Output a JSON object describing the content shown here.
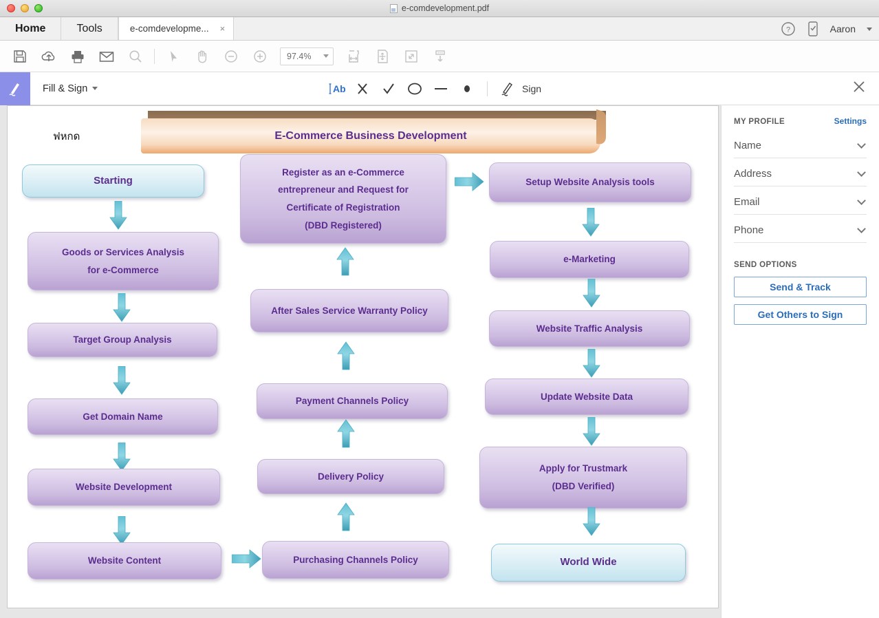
{
  "window": {
    "title": "e-comdevelopment.pdf",
    "traffic_lights": [
      "close",
      "minimize",
      "zoom"
    ]
  },
  "tabs": {
    "home_label": "Home",
    "tools_label": "Tools",
    "doc_label": "e-comdevelopme...",
    "close_label": "×"
  },
  "account": {
    "username": "Aaron",
    "help_icon": "help-circle-icon",
    "mobile_icon": "mobile-link-icon"
  },
  "toolbar": {
    "buttons": [
      {
        "name": "save-button",
        "icon": "floppy-disk-icon"
      },
      {
        "name": "upload-cloud-button",
        "icon": "cloud-upload-icon"
      },
      {
        "name": "print-button",
        "icon": "printer-icon"
      },
      {
        "name": "email-button",
        "icon": "envelope-icon"
      },
      {
        "name": "search-button",
        "icon": "magnifier-icon"
      },
      {
        "name": "select-tool-button",
        "icon": "cursor-arrow-icon"
      },
      {
        "name": "hand-tool-button",
        "icon": "hand-icon"
      },
      {
        "name": "zoom-out-button",
        "icon": "minus-circle-icon"
      },
      {
        "name": "zoom-in-button",
        "icon": "plus-circle-icon"
      },
      {
        "name": "fit-width-button",
        "icon": "fit-width-icon"
      },
      {
        "name": "fit-page-button",
        "icon": "fit-page-icon"
      },
      {
        "name": "full-screen-button",
        "icon": "expand-arrows-icon"
      },
      {
        "name": "scroll-down-button",
        "icon": "scroll-down-icon"
      }
    ],
    "zoom_value": "97.4%"
  },
  "fill_and_sign": {
    "mode_label": "Fill & Sign",
    "tools": [
      {
        "name": "add-text-tool",
        "glyph": "Ab",
        "active": true
      },
      {
        "name": "cross-mark-tool",
        "glyph": "✕",
        "active": false
      },
      {
        "name": "check-mark-tool",
        "glyph": "✓",
        "active": false
      },
      {
        "name": "circle-tool",
        "glyph": "◯",
        "active": false
      },
      {
        "name": "line-tool",
        "glyph": "—",
        "active": false
      },
      {
        "name": "dot-tool",
        "glyph": "●",
        "active": false
      }
    ],
    "sign_label": "Sign",
    "close_label": "✕"
  },
  "sidebar": {
    "profile_title": "MY PROFILE",
    "settings_link": "Settings",
    "fields": [
      {
        "label": "Name"
      },
      {
        "label": "Address"
      },
      {
        "label": "Email"
      },
      {
        "label": "Phone"
      }
    ],
    "send_options_title": "SEND OPTIONS",
    "buttons": [
      {
        "label": "Send & Track"
      },
      {
        "label": "Get Others to Sign"
      }
    ]
  },
  "document": {
    "banner_title": "E-Commerce Business Development",
    "annotation_text": "ฟหกด",
    "nodes": {
      "starting": "Starting",
      "goods_services": "Goods or Services Analysis\nfor e-Commerce",
      "goods_services_l1": "Goods or Services Analysis",
      "goods_services_l2": "for e-Commerce",
      "target_group": "Target Group Analysis",
      "get_domain": "Get Domain Name",
      "website_development": "Website Development",
      "website_content": "Website Content",
      "register_l1": "Register as an e-Commerce",
      "register_l2": "entrepreneur and Request for",
      "register_l3": "Certificate of Registration",
      "register_l4": "(DBD Registered)",
      "after_sales": "After Sales Service Warranty Policy",
      "payment_channels": "Payment Channels Policy",
      "delivery_policy": "Delivery Policy",
      "purchasing_channels": "Purchasing Channels Policy",
      "setup_analysis": "Setup Website Analysis tools",
      "e_marketing": "e-Marketing",
      "traffic_analysis": "Website Traffic Analysis",
      "update_data": "Update Website Data",
      "trustmark_l1": "Apply for Trustmark",
      "trustmark_l2": "(DBD Verified)",
      "world_wide": "World Wide"
    }
  },
  "colors": {
    "node_text": "#5b2d8e",
    "accent_blue": "#2b6cb8",
    "arrow_teal": "#4aaec4",
    "fill_sign_swatch": "#8b8fe8",
    "banner_orange": "#eda86f"
  }
}
